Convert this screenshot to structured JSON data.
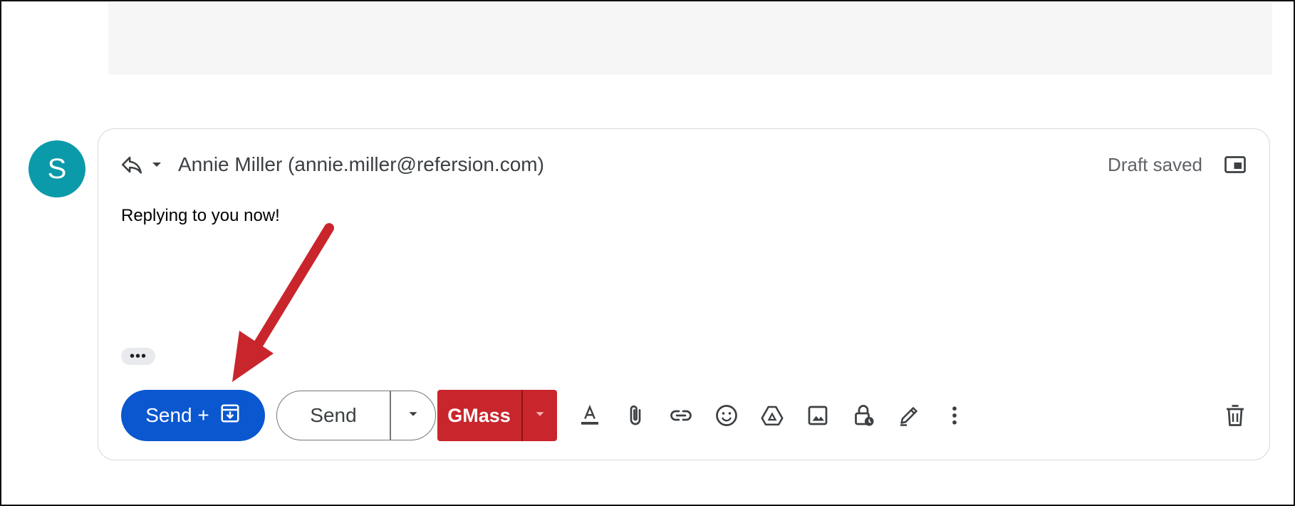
{
  "avatar": {
    "initial": "S",
    "color": "#0b9aa9"
  },
  "compose": {
    "recipient": "Annie Miller (annie.miller@refersion.com)",
    "draft_status": "Draft saved",
    "body": "Replying to you now!",
    "trimmed_content_label": "•••"
  },
  "toolbar": {
    "send_archive_label": "Send +",
    "send_label": "Send",
    "gmass_label": "GMass",
    "icons": [
      "reply-icon",
      "reply-options-chevron-icon",
      "popout-icon",
      "archive-icon",
      "chevron-down-icon",
      "text-color-icon",
      "attach-icon",
      "link-icon",
      "emoji-icon",
      "drive-icon",
      "photo-icon",
      "confidential-mode-icon",
      "signature-icon",
      "more-options-icon",
      "trash-icon"
    ]
  },
  "colors": {
    "send_archive": "#0b57d0",
    "gmass": "#c9252c",
    "annotation_arrow": "#c9252c"
  }
}
